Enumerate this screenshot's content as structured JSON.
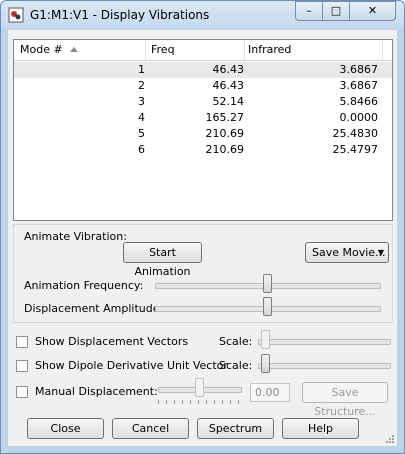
{
  "window": {
    "title": "G1:M1:V1 - Display Vibrations"
  },
  "table": {
    "columns": [
      "Mode #",
      "Freq",
      "Infrared"
    ],
    "rows": [
      {
        "mode": "1",
        "freq": "46.43",
        "ir": "3.6867"
      },
      {
        "mode": "2",
        "freq": "46.43",
        "ir": "3.6867"
      },
      {
        "mode": "3",
        "freq": "52.14",
        "ir": "5.8466"
      },
      {
        "mode": "4",
        "freq": "165.27",
        "ir": "0.0000"
      },
      {
        "mode": "5",
        "freq": "210.69",
        "ir": "25.4830"
      },
      {
        "mode": "6",
        "freq": "210.69",
        "ir": "25.4797"
      }
    ],
    "selected_row": 0
  },
  "animate": {
    "group_label": "Animate Vibration:",
    "start_label": "Start Animation",
    "save_movie_label": "Save Movie...",
    "frequency_label": "Animation Frequency:",
    "frequency_value": 0.5,
    "amplitude_label": "Displacement Amplitude:",
    "amplitude_value": 0.5
  },
  "options": {
    "show_displacement": "Show Displacement Vectors",
    "show_dipole": "Show Dipole Derivative Unit Vector",
    "manual_displacement": "Manual Displacement:",
    "scale_label": "Scale:",
    "manual_value": "0.00",
    "save_structure_label": "Save Structure...",
    "displacement_scale_value": 0.05,
    "dipole_scale_value": 0.05,
    "manual_slider_value": 0.5
  },
  "buttons": {
    "close": "Close",
    "cancel": "Cancel",
    "spectrum": "Spectrum",
    "help": "Help"
  }
}
